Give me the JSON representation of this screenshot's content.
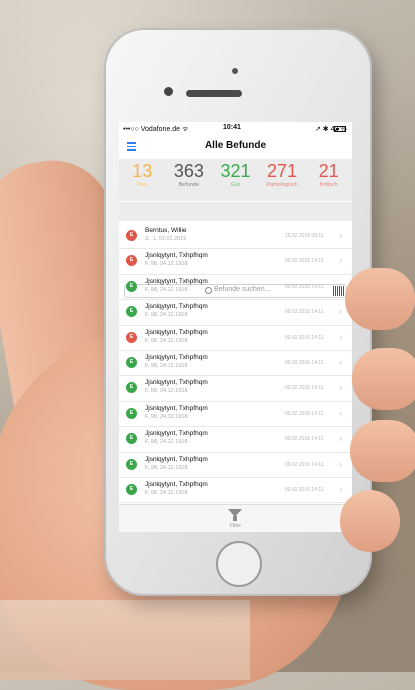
{
  "status_bar": {
    "carrier": "•••○○ Vodafone.de ᯤ",
    "time": "10:41",
    "battery_text": "↗ ✱ 42 %",
    "battery_level": 0.42
  },
  "nav": {
    "title": "Alle Befunde",
    "menu_icon": "hamburger-menu-icon"
  },
  "stats": [
    {
      "value": "13",
      "label": "Neu",
      "color": "#f5b54a"
    },
    {
      "value": "363",
      "label": "Befunde",
      "color": "#555555"
    },
    {
      "value": "321",
      "label": "Gut",
      "color": "#3aa84a"
    },
    {
      "value": "271",
      "label": "Pathologisch",
      "color": "#e2574c"
    },
    {
      "value": "21",
      "label": "Kritisch",
      "color": "#e2574c"
    }
  ],
  "search": {
    "placeholder": "Befunde suchen...",
    "icon": "search-icon",
    "scanner_icon": "barcode-icon"
  },
  "list": [
    {
      "name": "Berntus, Willie",
      "sub": "3., 1, 01.01.2015",
      "date": "15.02.2016 08:11",
      "status": "#e2574c",
      "letter": "E"
    },
    {
      "name": "Jjsnlqytynt, Txhpfhqm",
      "sub": "F, 98, 24.12.1918",
      "date": "09.02.2016 14:11",
      "status": "#e2574c",
      "letter": "E"
    },
    {
      "name": "Jjsnlqytynt, Txhpfhqm",
      "sub": "F, 98, 24.12.1918",
      "date": "09.02.2016 14:11",
      "status": "#3aa84a",
      "letter": "E"
    },
    {
      "name": "Jjsnlqytynt, Txhpfhqm",
      "sub": "F, 98, 24.12.1918",
      "date": "09.02.2016 14:11",
      "status": "#3aa84a",
      "letter": "E"
    },
    {
      "name": "Jjsnlqytynt, Txhpfhqm",
      "sub": "F, 98, 24.12.1918",
      "date": "09.02.2016 14:11",
      "status": "#e2574c",
      "letter": "E"
    },
    {
      "name": "Jjsnlqytynt, Txhpfhqm",
      "sub": "F, 98, 24.12.1918",
      "date": "09.02.2016 14:11",
      "status": "#3aa84a",
      "letter": "E"
    },
    {
      "name": "Jjsnlqytynt, Txhpfhqm",
      "sub": "F, 98, 24.12.1918",
      "date": "09.02.2016 14:11",
      "status": "#3aa84a",
      "letter": "E"
    },
    {
      "name": "Jjsnlqytynt, Txhpfhqm",
      "sub": "F, 98, 24.12.1918",
      "date": "09.02.2016 14:11",
      "status": "#3aa84a",
      "letter": "E"
    },
    {
      "name": "Jjsnlqytynt, Txhpfhqm",
      "sub": "F, 98, 24.12.1918",
      "date": "09.02.2016 14:11",
      "status": "#3aa84a",
      "letter": "E"
    },
    {
      "name": "Jjsnlqytynt, Txhpfhqm",
      "sub": "F, 98, 24.12.1918",
      "date": "09.02.2016 14:11",
      "status": "#3aa84a",
      "letter": "E"
    },
    {
      "name": "Jjsnlqytynt, Txhpfhqm",
      "sub": "F, 98, 24.12.1918",
      "date": "09.02.2016 14:11",
      "status": "#3aa84a",
      "letter": "E"
    },
    {
      "name": "Jjsnlqytynt, Txhpfhqm",
      "sub": "F, 98, 24.12.1918",
      "date": "09.02.2016 14:11",
      "status": "#3aa84a",
      "letter": "E"
    }
  ],
  "tabbar": {
    "filter_label": "Filter",
    "filter_icon": "filter-funnel-icon"
  }
}
